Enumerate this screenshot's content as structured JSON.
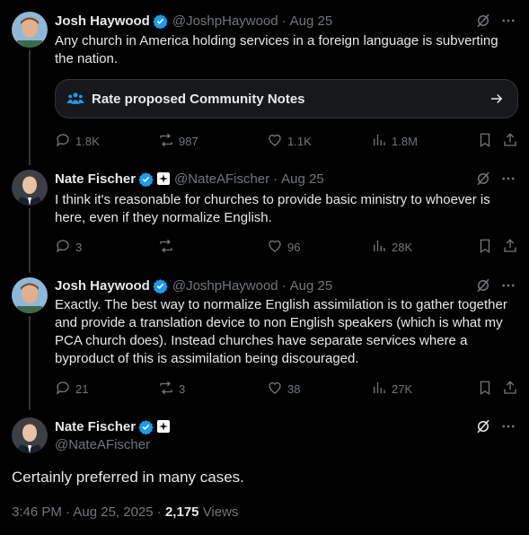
{
  "replies": [
    {
      "name": "Josh Haywood",
      "handle": "@JoshpHaywood",
      "date": "Aug 25",
      "text": "Any church in America holding services in a foreign language is subverting the nation.",
      "community_note": {
        "label": "Rate proposed Community Notes"
      },
      "stats": {
        "replies": "1.8K",
        "reposts": "987",
        "likes": "1.1K",
        "views": "1.8M"
      }
    },
    {
      "name": "Nate Fischer",
      "handle": "@NateAFischer",
      "date": "Aug 25",
      "text": "I think it's reasonable for churches to provide basic ministry to whoever is here, even if they normalize English.",
      "stats": {
        "replies": "3",
        "reposts": "",
        "likes": "96",
        "views": "28K"
      }
    },
    {
      "name": "Josh Haywood",
      "handle": "@JoshpHaywood",
      "date": "Aug 25",
      "text": "Exactly. The best way to normalize English assimilation is to gather together and provide a translation device to non English speakers (which is what my PCA church does). Instead churches have separate services where a byproduct of this is assimilation being discouraged.",
      "stats": {
        "replies": "21",
        "reposts": "3",
        "likes": "38",
        "views": "27K"
      }
    }
  ],
  "main_tweet": {
    "name": "Nate Fischer",
    "handle": "@NateAFischer",
    "text": "Certainly preferred in many cases.",
    "time": "3:46 PM · Aug 25, 2025",
    "sep": "·",
    "views_count": "2,175",
    "views_label": "Views"
  },
  "separator": "·",
  "colors": {
    "background": "#000000",
    "text": "#e7e9ea",
    "muted": "#71767b",
    "verified": "#1d9bf0",
    "divider": "#333639"
  },
  "icons": [
    "verified-badge-icon",
    "grok-icon",
    "more-icon",
    "reply-icon",
    "repost-icon",
    "like-icon",
    "views-icon",
    "bookmark-icon",
    "share-icon",
    "community-notes-icon",
    "arrow-right-icon",
    "affiliate-badge-icon"
  ]
}
